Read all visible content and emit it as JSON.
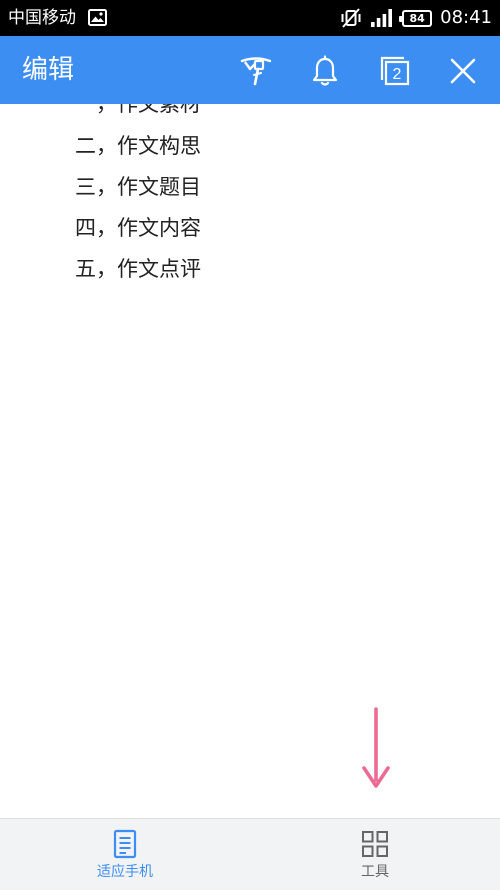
{
  "status_bar": {
    "carrier": "中国移动",
    "battery_level": "84",
    "time": "08:41"
  },
  "app_bar": {
    "title": "编辑",
    "page_count": "2",
    "bg_color": "#3d8ef2"
  },
  "document": {
    "lines": [
      "一，作文素材",
      "二，作文构思",
      "三，作文题目",
      "四，作文内容",
      "五，作文点评"
    ]
  },
  "bottom_bar": {
    "items": [
      {
        "label": "适应手机",
        "icon": "document-lines-icon",
        "active": true
      },
      {
        "label": "工具",
        "icon": "grid-icon",
        "active": false
      }
    ],
    "active_color": "#3d8ef2",
    "inactive_color": "#666666"
  },
  "annotation": {
    "arrow_color": "#ec6a93"
  }
}
